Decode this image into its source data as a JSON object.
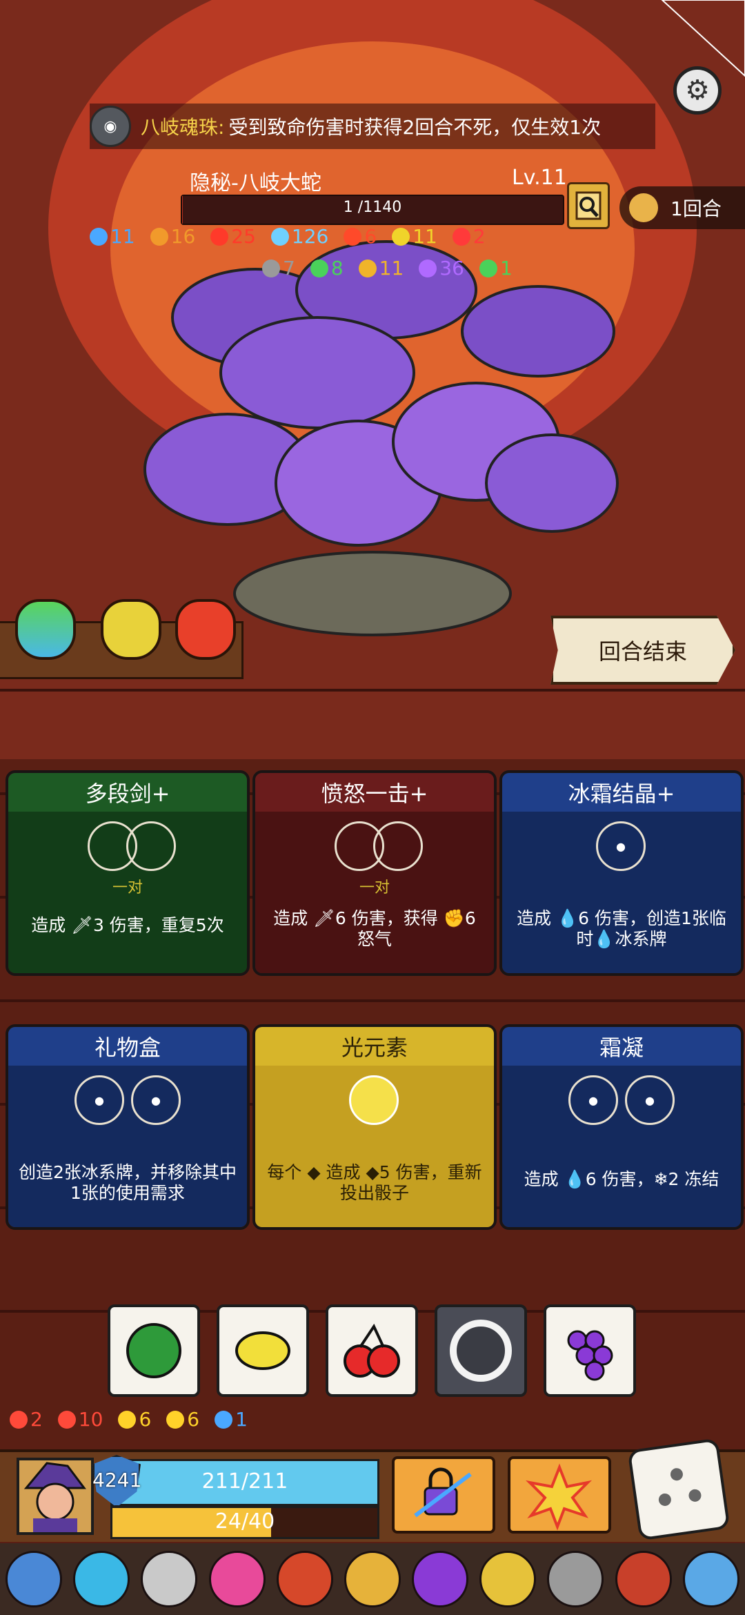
{
  "banner": {
    "relic_name": "八岐魂珠:",
    "relic_text": "受到致命伤害时获得2回合不死，仅生效1次"
  },
  "enemy": {
    "name": "隐秘-八岐大蛇",
    "level": "Lv.11",
    "hp_text": "1 /1140",
    "hp_fraction": 0.001,
    "stats_row1": [
      {
        "icon": "speech-icon",
        "value": "11",
        "color": "#4aa8ff"
      },
      {
        "icon": "flame-icon",
        "value": "16",
        "color": "#f19a2b"
      },
      {
        "icon": "blood-icon",
        "value": "25",
        "color": "#ff3a2a"
      },
      {
        "icon": "snowflake-icon",
        "value": "126",
        "color": "#6fd0ff"
      },
      {
        "icon": "fire-icon",
        "value": "6",
        "color": "#ff4a2a"
      },
      {
        "icon": "triangle-icon",
        "value": "11",
        "color": "#f0d42a"
      },
      {
        "icon": "heart-icon",
        "value": "2",
        "color": "#ff3a3a"
      }
    ],
    "stats_row2": [
      {
        "icon": "skull-icon",
        "value": "7",
        "color": "#9a9a9a"
      },
      {
        "icon": "virus-icon",
        "value": "8",
        "color": "#4ad25a"
      },
      {
        "icon": "lock-icon",
        "value": "11",
        "color": "#f0b42a"
      },
      {
        "icon": "sparkle-icon",
        "value": "36",
        "color": "#b06aff"
      },
      {
        "icon": "leaf-icon",
        "value": "1",
        "color": "#4ad25a"
      }
    ]
  },
  "turn": {
    "label": "1回合"
  },
  "end_turn_label": "回合结束",
  "cards": [
    {
      "title": "多段剑+",
      "slot_label": "一对",
      "desc": "造成 🗡3 伤害，重复5次",
      "theme": "green"
    },
    {
      "title": "愤怒一击+",
      "slot_label": "一对",
      "desc": "造成 🗡6 伤害，获得 ✊6 怒气",
      "theme": "red"
    },
    {
      "title": "冰霜结晶+",
      "slot_label": "",
      "desc": "造成 💧6 伤害，创造1张临时💧冰系牌",
      "theme": "blue"
    },
    {
      "title": "礼物盒",
      "slot_label": "",
      "desc": "创造2张冰系牌，并移除其中1张的使用需求",
      "theme": "blue"
    },
    {
      "title": "光元素",
      "slot_label": "",
      "desc": "每个 ◆ 造成 ◆5 伤害，重新投出骰子",
      "theme": "yellow"
    },
    {
      "title": "霜凝",
      "slot_label": "",
      "desc": "造成 💧6 伤害，❄2 冻结",
      "theme": "blue"
    }
  ],
  "dice": [
    {
      "icon": "watermelon-icon"
    },
    {
      "icon": "lemon-icon"
    },
    {
      "icon": "cherry-icon"
    },
    {
      "icon": "ring-icon"
    },
    {
      "icon": "grapes-icon"
    }
  ],
  "buffs": [
    {
      "icon": "burst-icon",
      "value": "2",
      "color": "#ff4a3a"
    },
    {
      "icon": "spiral-icon",
      "value": "10",
      "color": "#ff4a3a"
    },
    {
      "icon": "star-icon",
      "value": "6",
      "color": "#ffd22a"
    },
    {
      "icon": "shield-icon",
      "value": "6",
      "color": "#ffd22a"
    },
    {
      "icon": "swirl-icon",
      "value": "1",
      "color": "#4aa8ff"
    }
  ],
  "player": {
    "armor": "4241",
    "hp_text": "211/211",
    "hp_fraction": 1.0,
    "mana_text": "24/40",
    "mana_fraction": 0.6
  },
  "relics": [
    "sword-relic-icon",
    "crystal-relic-icon",
    "ring-relic-icon",
    "orb-relic-icon",
    "bracelet-relic-icon",
    "eye-relic-icon",
    "potion-relic-icon",
    "amulet-relic-icon",
    "helmet-relic-icon",
    "collar-relic-icon",
    "horn-relic-icon"
  ]
}
